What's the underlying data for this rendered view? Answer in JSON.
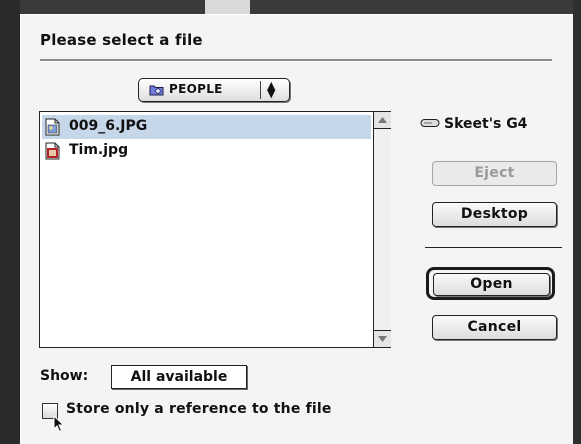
{
  "dialog": {
    "title": "Please select a file"
  },
  "folder_popup": {
    "label": "PEOPLE",
    "icon": "folder-icon"
  },
  "file_list": {
    "files": [
      {
        "name": "009_6.JPG",
        "icon": "image-file-icon",
        "selected": true
      },
      {
        "name": "Tim.jpg",
        "icon": "jpeg-file-icon",
        "selected": false
      }
    ]
  },
  "volume": {
    "name": "Skeet's G4",
    "icon": "hard-disk-icon"
  },
  "buttons": {
    "eject": "Eject",
    "desktop": "Desktop",
    "open": "Open",
    "cancel": "Cancel"
  },
  "show": {
    "label": "Show:",
    "value": "All available"
  },
  "reference_checkbox": {
    "label": "Store only a reference to the file",
    "checked": false
  },
  "colors": {
    "selection": "#c7d7ea",
    "background": "#f4f4f4"
  }
}
